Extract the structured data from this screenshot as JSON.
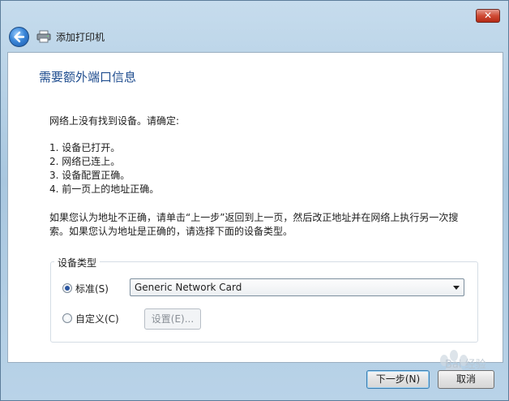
{
  "window": {
    "title": "添加打印机",
    "close_label": "✕"
  },
  "page": {
    "heading": "需要额外端口信息",
    "intro": "网络上没有找到设备。请确定:",
    "checklist": [
      "1.   设备已打开。",
      "2.   网络已连上。",
      "3.   设备配置正确。",
      "4.   前一页上的地址正确。"
    ],
    "paragraph_line1": "如果您认为地址不正确，请单击“上一步”返回到上一页，然后改正地址并在网络上执行另一次搜",
    "paragraph_line2": "索。如果您认为地址是正确的，请选择下面的设备类型。"
  },
  "device_type": {
    "legend": "设备类型",
    "standard_label": "标准(S)",
    "standard_selected": true,
    "standard_value": "Generic Network Card",
    "custom_label": "自定义(C)",
    "custom_selected": false,
    "settings_label": "设置(E)..."
  },
  "footer": {
    "next_label": "下一步(N)",
    "cancel_label": "取消"
  },
  "watermark": {
    "text": "Bai 经验"
  },
  "colors": {
    "heading": "#1f4d8f",
    "close_button": "#c8402b",
    "titlebar": "#b9d3e8"
  },
  "icons": [
    "back-arrow-icon",
    "printer-icon",
    "close-icon",
    "chevron-down-icon",
    "paw-icon"
  ]
}
